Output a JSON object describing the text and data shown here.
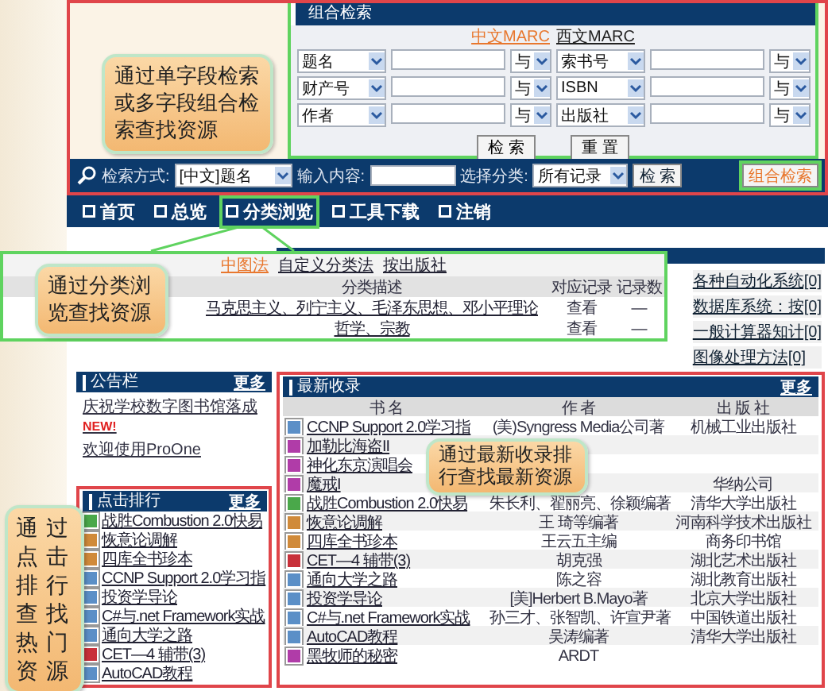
{
  "search_panel": {
    "title": "组合检索",
    "formats": [
      {
        "label": "中文MARC",
        "selected": true
      },
      {
        "label": "西文MARC",
        "selected": false
      }
    ],
    "rows": [
      {
        "field1": "题名",
        "op1": "与",
        "field2": "索书号",
        "op2": "与"
      },
      {
        "field1": "财产号",
        "op1": "与",
        "field2": "ISBN",
        "op2": "与"
      },
      {
        "field1": "作者",
        "op1": "与",
        "field2": "出版社",
        "op2": "与"
      }
    ],
    "buttons": [
      "检 索",
      "重 置"
    ]
  },
  "search_bar": {
    "mode_label": "检索方式:",
    "mode": "[中文]题名",
    "input_label": "输入内容:",
    "category_label": "选择分类:",
    "category": "所有记录",
    "search_button": "检 索",
    "advanced_button": "组合检索",
    "advanced_highlighted": true
  },
  "nav": [
    {
      "label": "首页",
      "highlighted": false
    },
    {
      "label": "总览",
      "highlighted": false
    },
    {
      "label": "分类浏览",
      "highlighted": true
    },
    {
      "label": "工具下载",
      "highlighted": false
    },
    {
      "label": "注销",
      "highlighted": false
    }
  ],
  "category_panel": {
    "schemes": [
      {
        "label": "中图法",
        "selected": true
      },
      {
        "label": "自定义分类法",
        "selected": false
      },
      {
        "label": "按出版社",
        "selected": false
      }
    ],
    "columns": [
      "分类描述",
      "对应记录",
      "记录数"
    ],
    "rows": [
      {
        "description": "马克思主义、列宁主义、毛泽东思想、邓小平理论",
        "link": "查看",
        "count": "—"
      },
      {
        "description": "哲学、宗教",
        "link": "查看",
        "count": "—"
      }
    ]
  },
  "category_list": [
    "各种自动化系统[0]",
    "数据库系统：按[0]",
    "一般计算器知计[0]",
    "图像处理方法[0]"
  ],
  "notices": {
    "title": "公告栏",
    "more": "更多",
    "items": [
      {
        "text": "庆祝学校数字图书馆落成",
        "badge": "NEW!"
      },
      {
        "text": "欢迎使用ProOne"
      }
    ]
  },
  "ranking": {
    "title": "点击排行",
    "more": "更多",
    "items": [
      {
        "title": "战胜Combustion 2.0快易",
        "color": "#4aa84a"
      },
      {
        "title": "恢意论调解",
        "color": "#d08a3a"
      },
      {
        "title": "四库全书珍本",
        "color": "#d08a3a"
      },
      {
        "title": "CCNP Support 2.0学习指",
        "color": "#5b8fc7"
      },
      {
        "title": "投资学导论",
        "color": "#5b8fc7"
      },
      {
        "title": "C#与.net Framework实战",
        "color": "#5b8fc7"
      },
      {
        "title": "通向大学之路",
        "color": "#5b8fc7"
      },
      {
        "title": "CET—4 辅带(3)",
        "color": "#c8303a"
      },
      {
        "title": "AutoCAD教程",
        "color": "#5b8fc7"
      }
    ]
  },
  "latest": {
    "title": "最新收录",
    "more": "更多",
    "columns": [
      "书 名",
      "作 者",
      "出 版 社"
    ],
    "rows": [
      {
        "title": "CCNP Support 2.0学习指",
        "author": "(美)Syngress Media公司著",
        "publisher": "机械工业出版社",
        "color": "#5b8fc7"
      },
      {
        "title": "加勒比海盗II",
        "color": "#b03ca8"
      },
      {
        "title": "神化东京演唱会",
        "color": "#b03ca8"
      },
      {
        "title": "魔戒I",
        "publisher": "华纳公司",
        "color": "#b03ca8"
      },
      {
        "title": "战胜Combustion 2.0快易",
        "author": "朱长利、翟丽亮、徐颖编著",
        "publisher": "清华大学出版社",
        "color": "#4aa84a"
      },
      {
        "title": "恢意论调解",
        "author": "王 琦等编著",
        "publisher": "河南科学技术出版社",
        "color": "#d08a3a"
      },
      {
        "title": "四库全书珍本",
        "author": "王云五主编",
        "publisher": "商务印书馆",
        "color": "#d08a3a"
      },
      {
        "title": "CET—4 辅带(3)",
        "author": "胡克强",
        "publisher": "湖北艺术出版社",
        "color": "#c8303a"
      },
      {
        "title": "通向大学之路",
        "author": "陈之容",
        "publisher": "湖北教育出版社",
        "color": "#5b8fc7"
      },
      {
        "title": "投资学导论",
        "author": "[美]Herbert B.Mayo著",
        "publisher": "北京大学出版社",
        "color": "#5b8fc7"
      },
      {
        "title": "C#与.net Framework实战",
        "author": "孙三才、张智凯、许宣尹著",
        "publisher": "中国铁道出版社",
        "color": "#5b8fc7"
      },
      {
        "title": "AutoCAD教程",
        "author": "吴涛编著",
        "publisher": "清华大学出版社",
        "color": "#5b8fc7"
      },
      {
        "title": "黑牧师的秘密",
        "author": "ARDT",
        "color": "#b03ca8"
      }
    ]
  },
  "callouts": [
    {
      "text": "通过单字段检索或多字段组合检索查找资源"
    },
    {
      "text": "通过分类浏览查找资源"
    },
    {
      "text": "通过最新收录排行查找最新资源"
    },
    {
      "text": "通过点击排行查找热门资源"
    }
  ]
}
